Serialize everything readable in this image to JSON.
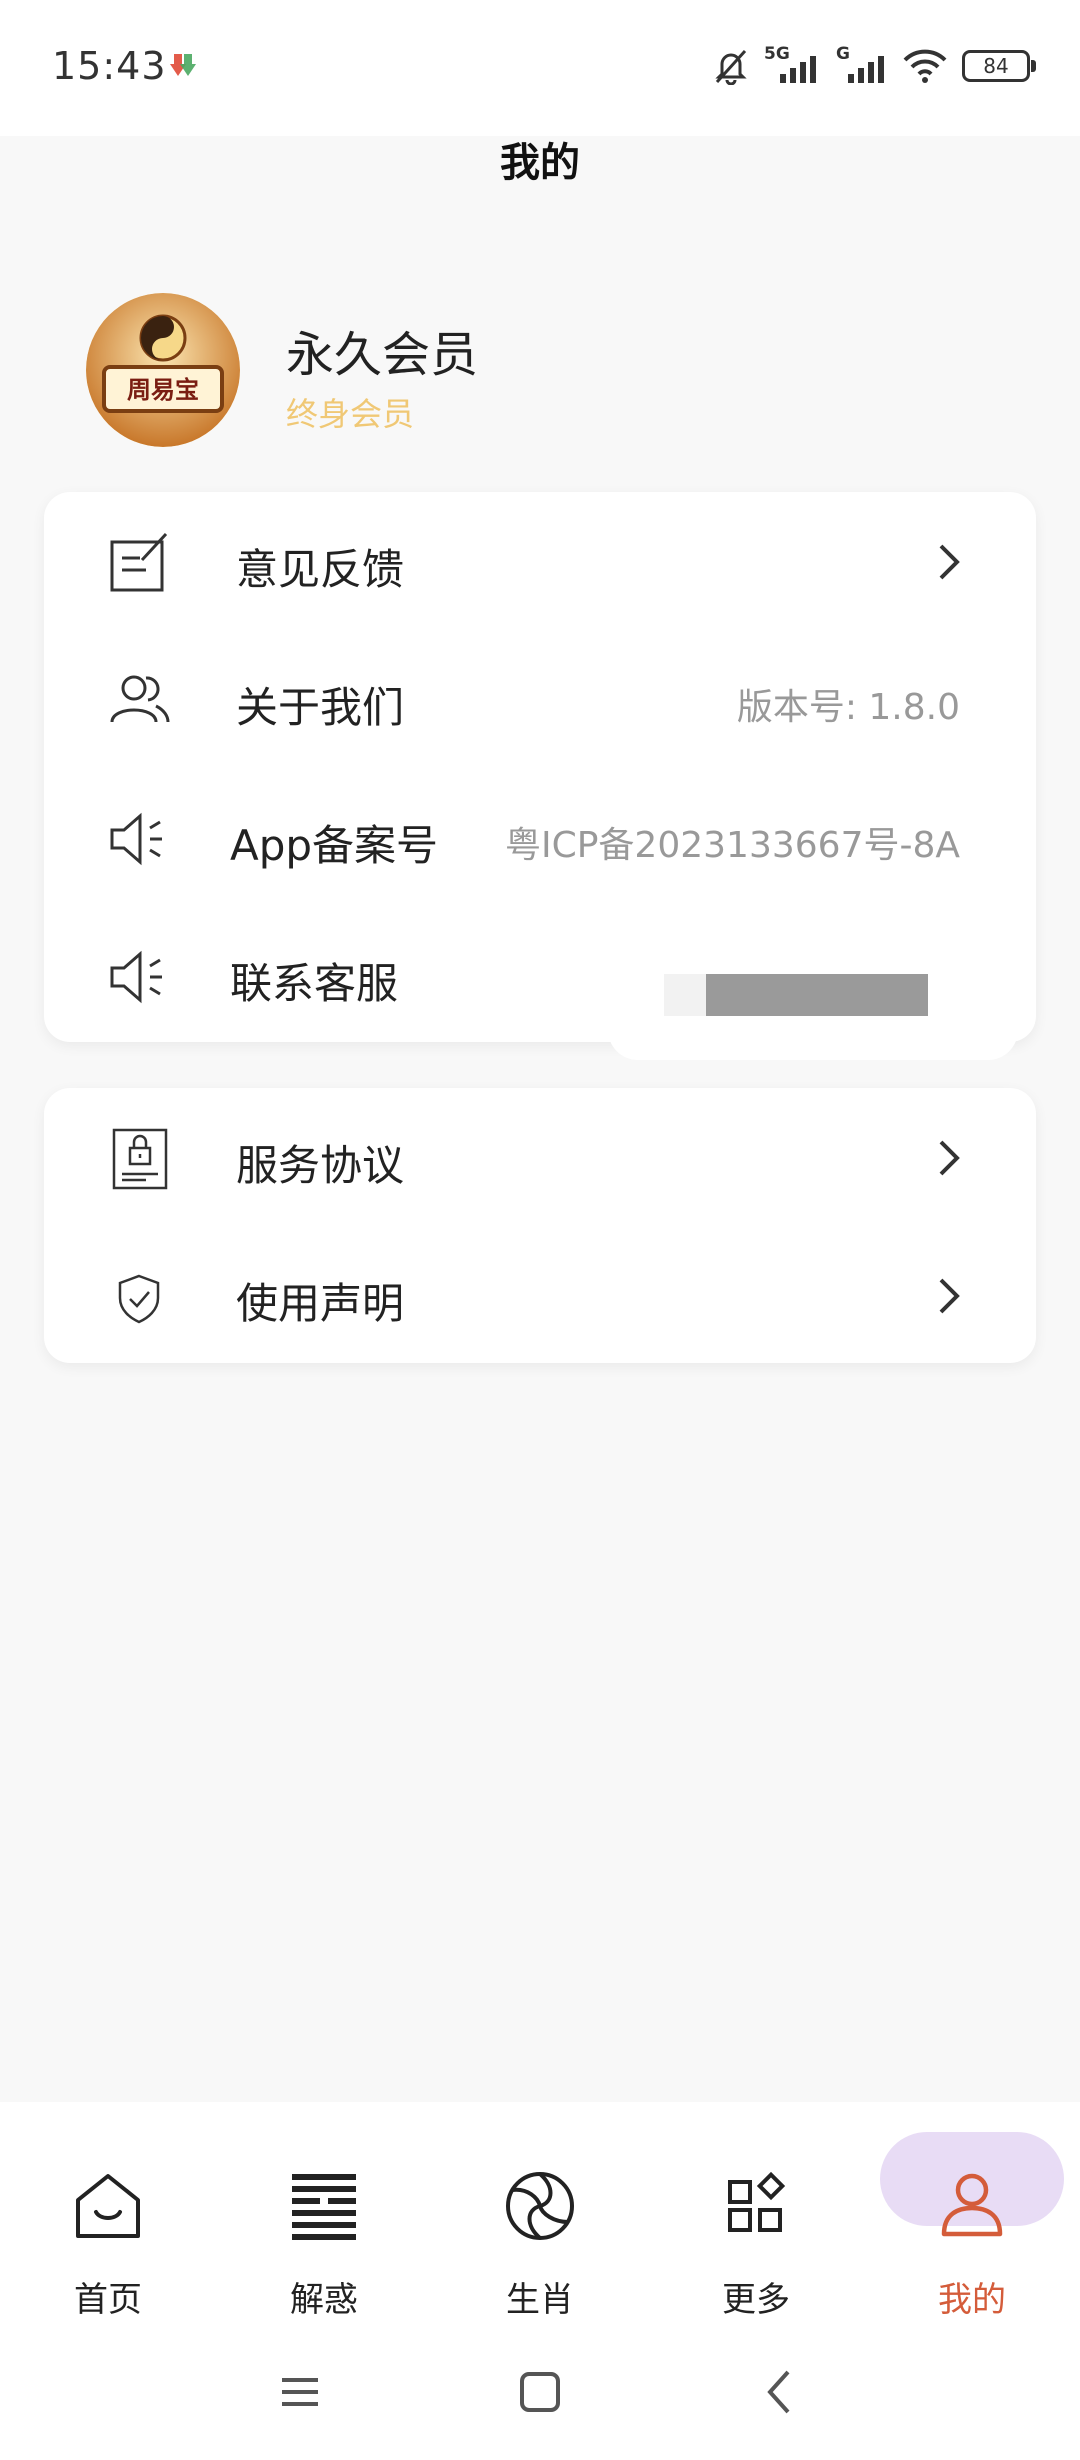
{
  "status_bar": {
    "time": "15:43",
    "signal1_label": "5G",
    "signal2_label": "G",
    "battery": "84"
  },
  "page_title": "我的",
  "profile": {
    "name": "永久会员",
    "subtitle": "终身会员",
    "avatar_text": "周易宝"
  },
  "menu_group_1": [
    {
      "label": "意见反馈",
      "value": "",
      "chevron": true,
      "icon": "edit-note-icon"
    },
    {
      "label": "关于我们",
      "value": "版本号: 1.8.0",
      "chevron": false,
      "icon": "people-icon"
    },
    {
      "label": "App备案号",
      "value": "粤ICP备2023133667号-8A",
      "chevron": false,
      "icon": "speaker-icon"
    },
    {
      "label": "联系客服",
      "value": "",
      "chevron": false,
      "icon": "speaker-icon"
    }
  ],
  "menu_group_2": [
    {
      "label": "服务协议",
      "chevron": true,
      "icon": "document-lock-icon"
    },
    {
      "label": "使用声明",
      "chevron": true,
      "icon": "shield-check-icon"
    }
  ],
  "bottom_nav": [
    {
      "label": "首页",
      "icon": "home-icon"
    },
    {
      "label": "解惑",
      "icon": "hexagram-icon"
    },
    {
      "label": "生肖",
      "icon": "zodiac-icon"
    },
    {
      "label": "更多",
      "icon": "apps-icon"
    },
    {
      "label": "我的",
      "icon": "user-icon",
      "active": true
    }
  ],
  "colors": {
    "accent": "#d45c3a",
    "active_pill": "#e8dcf5",
    "member_gold": "#f0c875"
  }
}
